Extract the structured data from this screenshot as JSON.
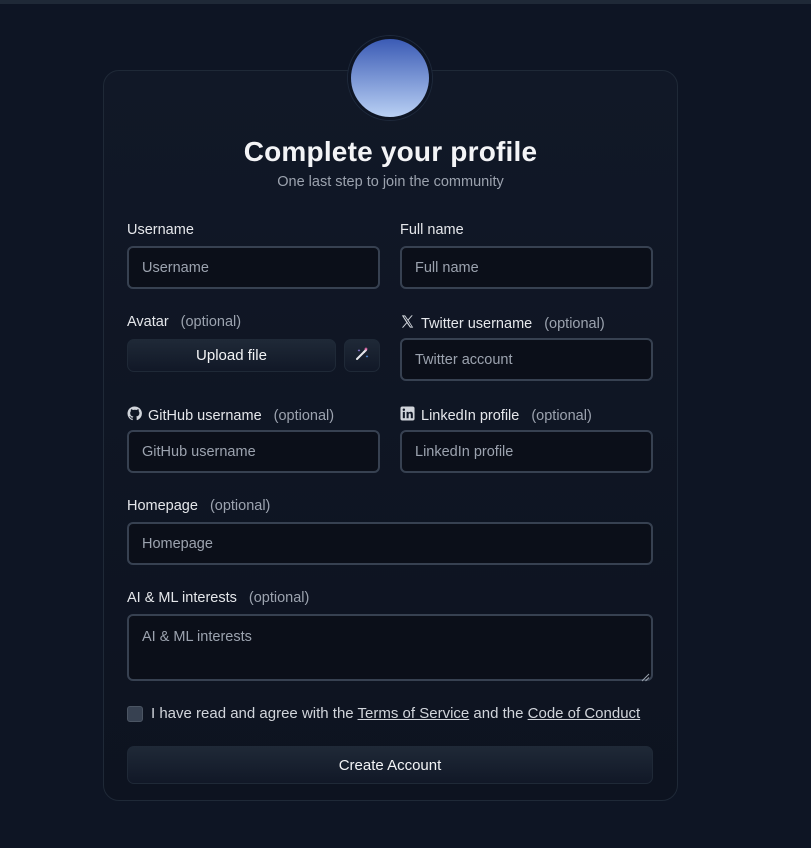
{
  "header": {
    "title": "Complete your profile",
    "subtitle": "One last step to join the community"
  },
  "fields": {
    "username": {
      "label": "Username",
      "placeholder": "Username",
      "value": ""
    },
    "fullname": {
      "label": "Full name",
      "placeholder": "Full name",
      "value": ""
    },
    "avatar": {
      "label": "Avatar",
      "optional": "(optional)",
      "upload_label": "Upload file",
      "magic_icon": "magic-wand-icon"
    },
    "twitter": {
      "label": "Twitter username",
      "optional": "(optional)",
      "placeholder": "Twitter account",
      "icon": "x-logo-icon"
    },
    "github": {
      "label": "GitHub username",
      "optional": "(optional)",
      "placeholder": "GitHub username",
      "icon": "github-icon"
    },
    "linkedin": {
      "label": "LinkedIn profile",
      "optional": "(optional)",
      "placeholder": "LinkedIn profile",
      "icon": "linkedin-icon"
    },
    "homepage": {
      "label": "Homepage",
      "optional": "(optional)",
      "placeholder": "Homepage"
    },
    "interests": {
      "label": "AI & ML interests",
      "optional": "(optional)",
      "placeholder": "AI & ML interests"
    }
  },
  "agreement": {
    "checked": false,
    "prefix": "I have read and agree with the",
    "terms_link": "Terms of Service",
    "middle": "and the",
    "conduct_link": "Code of Conduct"
  },
  "submit_label": "Create Account",
  "colors": {
    "background": "#0e1524",
    "card": "#111827",
    "input_border": "#374151",
    "avatar_gradient_top": "#3b5bb5",
    "avatar_gradient_bottom": "#b9d0f4"
  }
}
